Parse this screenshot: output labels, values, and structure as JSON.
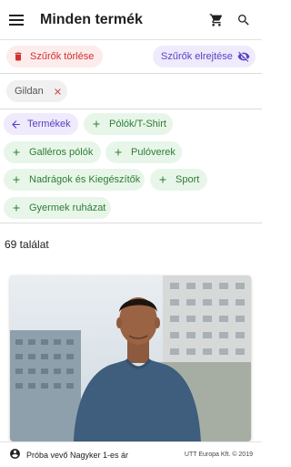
{
  "header": {
    "title": "Minden termék",
    "icons": [
      "menu-icon",
      "cart-icon",
      "search-icon"
    ]
  },
  "actions": {
    "clear_filters": "Szűrők törlése",
    "hide_filters": "Szűrők elrejtése"
  },
  "active_filters": [
    {
      "label": "Gildan"
    }
  ],
  "categories": {
    "back": "Termékek",
    "items": [
      "Pólók/T-Shirt",
      "Galléros pólók",
      "Pulóverek",
      "Nadrágok és Kiegészítők",
      "Sport",
      "Gyermek ruházat"
    ]
  },
  "results": {
    "text": "69 találat"
  },
  "footer": {
    "user": "Próba vevő Nagyker 1-es ár",
    "copyright": "UTT Europa Kft. © 2019"
  },
  "colors": {
    "red": "#d32f2f",
    "purple": "#5b3fc4",
    "green": "#2e7d32"
  }
}
